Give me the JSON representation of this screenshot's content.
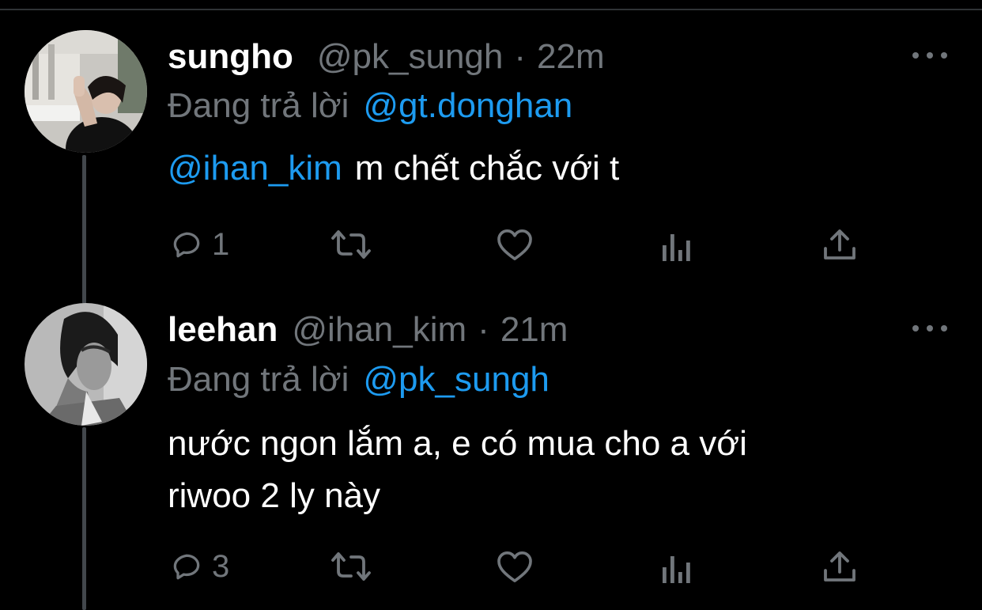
{
  "tweets": [
    {
      "display_name": "sungho",
      "handle": "@pk_sungh",
      "dot": "·",
      "time": "22m",
      "replying_prefix": "Đang trả lời",
      "replying_to": "@gt.donghan",
      "text_mention": "@ihan_kim",
      "text": "m chết chắc với t",
      "reply_count": "1",
      "retweet_count": "",
      "like_count": ""
    },
    {
      "display_name": "leehan",
      "handle": "@ihan_kim",
      "dot": "·",
      "time": "21m",
      "replying_prefix": "Đang trả lời",
      "replying_to": "@pk_sungh",
      "text_line1": "nước ngon lắm a, e có mua cho a với",
      "text_line2": "riwoo 2 ly này",
      "reply_count": "3",
      "retweet_count": "",
      "like_count": ""
    }
  ],
  "icons": {
    "reply": "reply-icon",
    "retweet": "retweet-icon",
    "like": "heart-icon",
    "views": "analytics-icon",
    "share": "share-icon",
    "more": "more-dots-icon"
  },
  "colors": {
    "background": "#000000",
    "text": "#ffffff",
    "secondary": "#71767b",
    "accent": "#1d9bf0",
    "thread_line": "#42474c"
  }
}
